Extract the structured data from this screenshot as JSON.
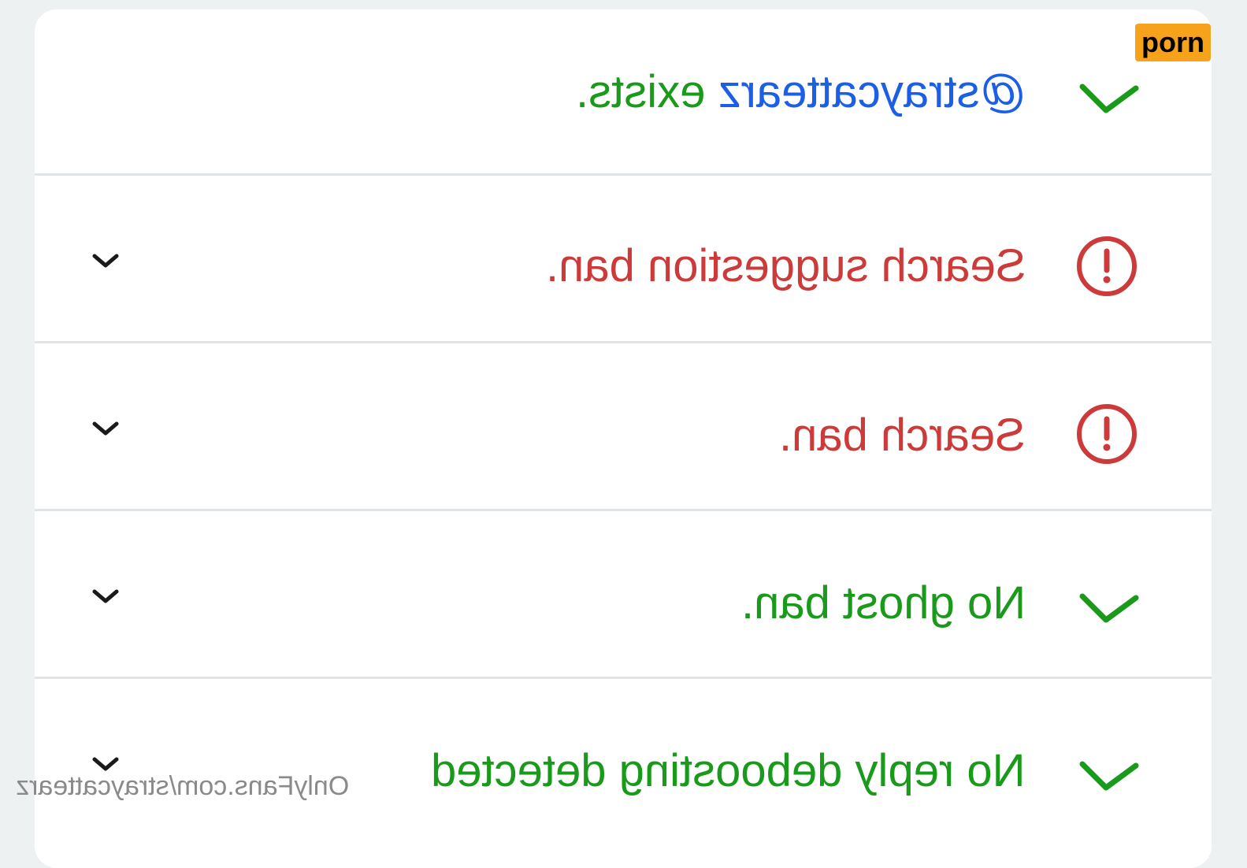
{
  "colors": {
    "success": "#1a9a1a",
    "error": "#cc3a3a",
    "link": "#1a5fe6",
    "text": "#1a1a1a",
    "watermark": "#8a8a8a",
    "badge_bg": "#f7a21b"
  },
  "rows": [
    {
      "status": "success",
      "status_icon": "check-icon",
      "handle": "@straycattearz",
      "text": " exists.",
      "expandable": false
    },
    {
      "status": "error",
      "status_icon": "alert-circle-icon",
      "text": "Search suggestion ban.",
      "expandable": true,
      "expand_icon": "chevron-down-icon"
    },
    {
      "status": "error",
      "status_icon": "alert-circle-icon",
      "text": "Search ban.",
      "expandable": true,
      "expand_icon": "chevron-down-icon"
    },
    {
      "status": "success",
      "status_icon": "check-icon",
      "text": "No ghost ban.",
      "expandable": true,
      "expand_icon": "chevron-down-icon"
    },
    {
      "status": "success",
      "status_icon": "check-icon",
      "text": "No reply deboosting detected",
      "expandable": true,
      "expand_icon": "chevron-down-icon"
    }
  ],
  "watermark": "OnlyFans.com/straycattearz",
  "badge": "porn"
}
